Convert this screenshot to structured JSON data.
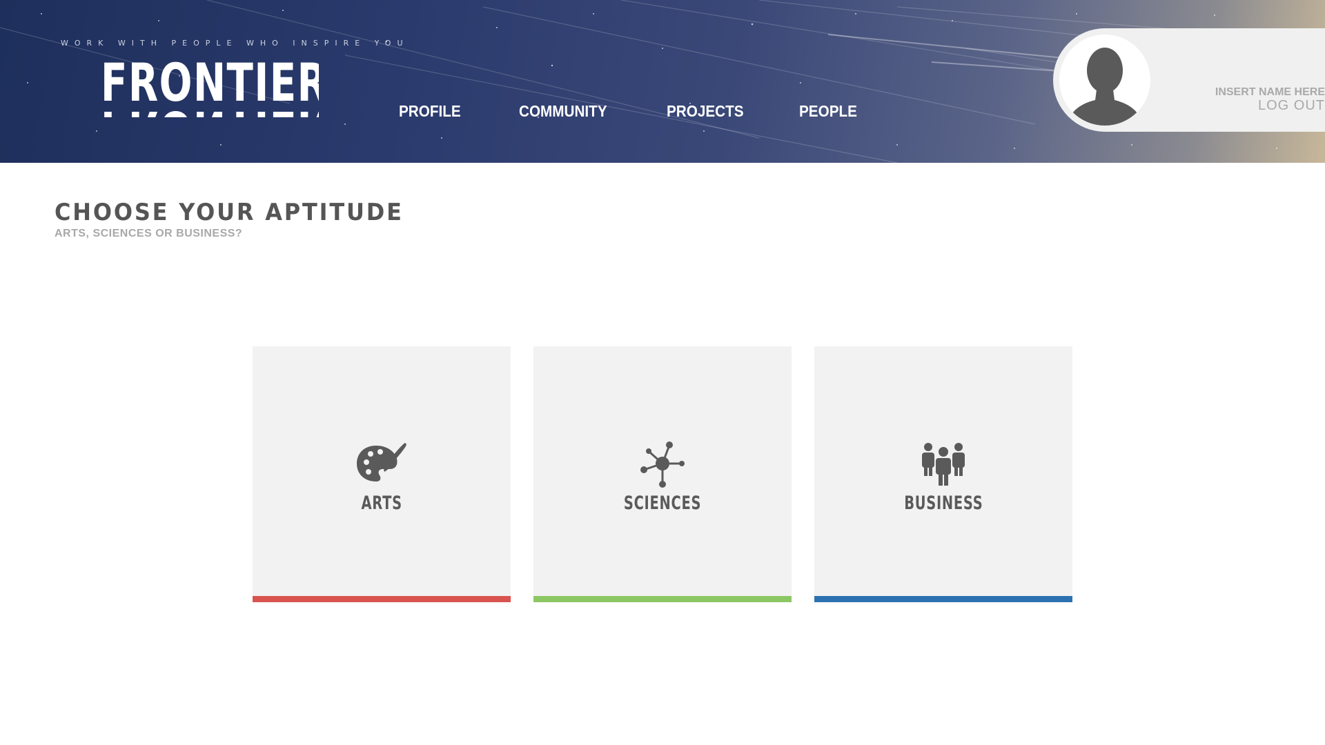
{
  "header": {
    "tagline": "WORK WITH PEOPLE WHO INSPIRE YOU",
    "logo_text": "FRONTIER",
    "nav": [
      {
        "label": "PROFILE"
      },
      {
        "label": "COMMUNITY"
      },
      {
        "label": "PROJECTS"
      },
      {
        "label": "PEOPLE"
      }
    ]
  },
  "user": {
    "name": "INSERT NAME HERE",
    "logout_label": "LOG OUT"
  },
  "main": {
    "title": "CHOOSE YOUR APTITUDE",
    "subtitle": "ARTS, SCIENCES OR BUSINESS?",
    "cards": [
      {
        "label": "ARTS",
        "icon": "palette-icon",
        "accent": "#d9534f"
      },
      {
        "label": "SCIENCES",
        "icon": "molecule-icon",
        "accent": "#8cc764"
      },
      {
        "label": "BUSINESS",
        "icon": "people-group-icon",
        "accent": "#2d72b0"
      }
    ]
  },
  "colors": {
    "card_background": "#f2f2f2",
    "icon_gray": "#5a5a5a",
    "title_gray": "#555555",
    "subtitle_gray": "#a8a8a8"
  }
}
